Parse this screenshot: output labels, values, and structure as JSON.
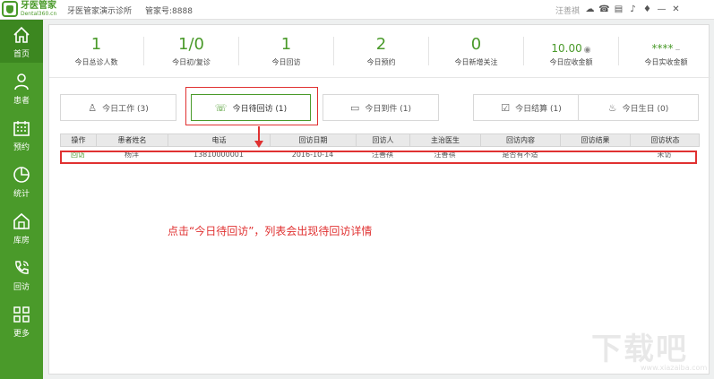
{
  "app": {
    "logo_text": "牙医管家",
    "logo_sub": "Dental360.cn",
    "clinic_name": "牙医管家演示诊所",
    "account": "管家号:8888",
    "user_name": "汪善祺",
    "topbar_icons": [
      "weibo-icon",
      "phone-icon",
      "clipboard-icon",
      "bell-icon",
      "shirt-icon",
      "minimize-icon",
      "close-icon"
    ]
  },
  "sidebar": {
    "accent": "#4a9a2a",
    "items": [
      {
        "label": "首页",
        "icon": "home-icon"
      },
      {
        "label": "患者",
        "icon": "patient-icon"
      },
      {
        "label": "预约",
        "icon": "calendar-icon"
      },
      {
        "label": "统计",
        "icon": "pie-chart-icon"
      },
      {
        "label": "库房",
        "icon": "warehouse-icon"
      },
      {
        "label": "回访",
        "icon": "phone-call-icon"
      },
      {
        "label": "更多",
        "icon": "grid-icon"
      }
    ]
  },
  "stats": [
    {
      "value": "1",
      "label": "今日总诊人数"
    },
    {
      "value": "1/0",
      "label": "今日初/复诊"
    },
    {
      "value": "1",
      "label": "今日回访"
    },
    {
      "value": "2",
      "label": "今日预约"
    },
    {
      "value": "0",
      "label": "今日新增关注"
    },
    {
      "value": "10.00",
      "label": "今日应收金额"
    },
    {
      "value": "****",
      "label": "今日实收金额"
    }
  ],
  "tabs": [
    {
      "label": "今日工作 (3)",
      "icon": "user-icon"
    },
    {
      "label": "今日待回访 (1)",
      "icon": "phone-call-icon"
    },
    {
      "label": "今日到件 (1)",
      "icon": "box-icon"
    },
    {
      "label": "今日结算 (1)",
      "icon": "checkbox-icon"
    },
    {
      "label": "今日生日 (0)",
      "icon": "cake-icon"
    }
  ],
  "table": {
    "headers": [
      "操作",
      "患者姓名",
      "电话",
      "回访日期",
      "回访人",
      "主治医生",
      "回访内容",
      "回访结果",
      "回访状态"
    ],
    "rows": [
      [
        "回访",
        "杨洋",
        "13810000001",
        "2016-10-14",
        "汪善祺",
        "汪善祺",
        "是否有不适",
        "",
        "未访"
      ]
    ]
  },
  "annotation": "点击“今日待回访”，列表会出现待回访详情",
  "watermark": {
    "text": "下载吧",
    "url": "www.xiazaiba.com"
  },
  "colors": {
    "accent": "#4a9a2a",
    "highlight": "#e03131"
  }
}
